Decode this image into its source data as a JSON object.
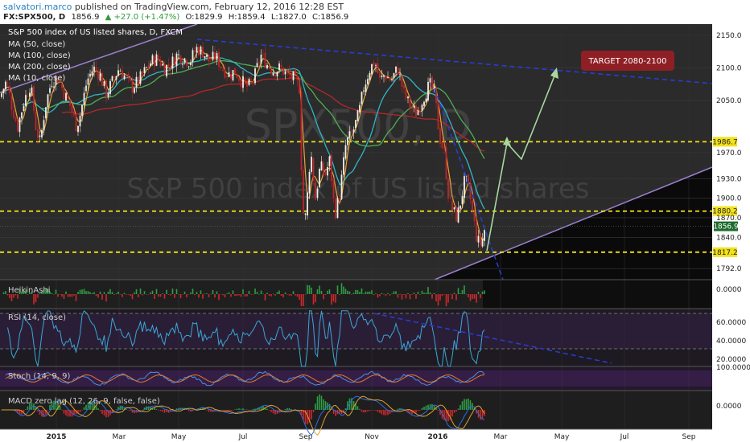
{
  "header": {
    "author": "salvatori.marco",
    "published_text": "published on TradingView.com, February 12, 2016 12:28 EST",
    "symbol": "FX:SPX500, D",
    "last": "1856.9",
    "change": "+27.0 (+1.47%)",
    "open": "O:1829.9",
    "high": "H:1859.4",
    "low": "L:1827.0",
    "close": "C:1856.9"
  },
  "chart_data": {
    "type": "candlestick",
    "title": "S&P 500 index of US listed shares, D, FXCM",
    "watermark": [
      "SPX500, D",
      "S&P 500 index of US listed shares"
    ],
    "ylim": [
      1775,
      2160
    ],
    "y_ticks": [
      1792,
      1840,
      1870,
      1900,
      1930,
      1970,
      2050,
      2100,
      2150
    ],
    "y_tick_labels": [
      "1792.0",
      "1840.0",
      "1870.0",
      "1900.0",
      "1930.0",
      "1970.0",
      "2050.0",
      "2100.0",
      "2150.0"
    ],
    "x_ticks": [
      "2015",
      "Mar",
      "May",
      "Jul",
      "Sep",
      "Nov",
      "2016",
      "Mar",
      "May",
      "Jul",
      "Sep"
    ],
    "ma_legend": [
      "MA (50, close)",
      "MA (100, close)",
      "MA (200, close)",
      "MA (10, close)"
    ],
    "price_path": [
      [
        0,
        2055
      ],
      [
        8,
        2080
      ],
      [
        15,
        2040
      ],
      [
        22,
        2010
      ],
      [
        30,
        2050
      ],
      [
        38,
        2075
      ],
      [
        45,
        2005
      ],
      [
        50,
        1985
      ],
      [
        56,
        2040
      ],
      [
        64,
        2080
      ],
      [
        72,
        2085
      ],
      [
        80,
        2060
      ],
      [
        88,
        2040
      ],
      [
        95,
        2010
      ],
      [
        100,
        2030
      ],
      [
        108,
        2080
      ],
      [
        116,
        2100
      ],
      [
        124,
        2090
      ],
      [
        132,
        2060
      ],
      [
        140,
        2080
      ],
      [
        148,
        2100
      ],
      [
        156,
        2085
      ],
      [
        164,
        2070
      ],
      [
        172,
        2080
      ],
      [
        180,
        2095
      ],
      [
        188,
        2110
      ],
      [
        196,
        2115
      ],
      [
        204,
        2100
      ],
      [
        212,
        2105
      ],
      [
        220,
        2120
      ],
      [
        228,
        2115
      ],
      [
        236,
        2110
      ],
      [
        244,
        2130
      ],
      [
        252,
        2125
      ],
      [
        260,
        2110
      ],
      [
        268,
        2118
      ],
      [
        276,
        2100
      ],
      [
        284,
        2090
      ],
      [
        292,
        2095
      ],
      [
        300,
        2080
      ],
      [
        308,
        2070
      ],
      [
        316,
        2085
      ],
      [
        324,
        2120
      ],
      [
        332,
        2105
      ],
      [
        340,
        2095
      ],
      [
        348,
        2100
      ],
      [
        356,
        2090
      ],
      [
        364,
        2085
      ],
      [
        372,
        2070
      ],
      [
        376,
        1880
      ],
      [
        380,
        1870
      ],
      [
        386,
        1975
      ],
      [
        392,
        1900
      ],
      [
        398,
        1950
      ],
      [
        404,
        1935
      ],
      [
        410,
        1960
      ],
      [
        416,
        1875
      ],
      [
        422,
        1905
      ],
      [
        430,
        1985
      ],
      [
        438,
        2000
      ],
      [
        446,
        2030
      ],
      [
        452,
        2070
      ],
      [
        460,
        2100
      ],
      [
        466,
        2110
      ],
      [
        472,
        2080
      ],
      [
        478,
        2090
      ],
      [
        486,
        2080
      ],
      [
        494,
        2100
      ],
      [
        502,
        2060
      ],
      [
        510,
        2040
      ],
      [
        518,
        2030
      ],
      [
        526,
        2055
      ],
      [
        534,
        2075
      ],
      [
        540,
        2060
      ],
      [
        546,
        1995
      ],
      [
        552,
        1970
      ],
      [
        558,
        1895
      ],
      [
        563,
        1880
      ],
      [
        568,
        1870
      ],
      [
        574,
        1905
      ],
      [
        578,
        1930
      ],
      [
        583,
        1910
      ],
      [
        588,
        1870
      ],
      [
        593,
        1835
      ],
      [
        598,
        1829
      ],
      [
        603,
        1857
      ]
    ],
    "levels": [
      {
        "value": 1986.7,
        "label": "1986.7",
        "color": "#f2e21a",
        "style": "dashed"
      },
      {
        "value": 1880.2,
        "label": "1880.2",
        "color": "#f2e21a",
        "style": "dashed"
      },
      {
        "value": 1817.2,
        "label": "1817.2",
        "color": "#f2e21a",
        "style": "dashed"
      }
    ],
    "last_price": {
      "value": 1856.9,
      "label": "1856.9"
    },
    "annotation": "TARGET 2080-2100",
    "indicators": {
      "heikin": {
        "label": "HeikinAshi",
        "value": "0.0000"
      },
      "rsi": {
        "label": "RSI (14, close)",
        "ticks": [
          "60.0000",
          "40.0000",
          "20.0000"
        ]
      },
      "stoch": {
        "label": "Stoch (14, 9, 9)",
        "value": "100.0000"
      },
      "macd": {
        "label": "MACD zero lag (12, 26, 9, false, false)",
        "value": "0.0000"
      }
    }
  }
}
